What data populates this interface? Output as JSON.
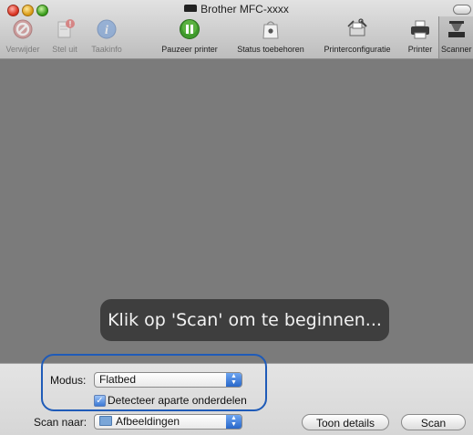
{
  "window": {
    "title": "Brother MFC-xxxx"
  },
  "toolbar": {
    "items": [
      {
        "label": "Verwijder",
        "icon": "delete-icon",
        "disabled": true
      },
      {
        "label": "Stel uit",
        "icon": "hold-icon",
        "disabled": true
      },
      {
        "label": "Taakinfo",
        "icon": "info-icon",
        "disabled": true
      },
      {
        "label": "Pauzeer printer",
        "icon": "pause-icon",
        "disabled": false
      },
      {
        "label": "Status toebehoren",
        "icon": "supplies-icon",
        "disabled": false
      },
      {
        "label": "Printerconfiguratie",
        "icon": "configure-icon",
        "disabled": false
      },
      {
        "label": "Printer",
        "icon": "printer-icon",
        "disabled": false
      },
      {
        "label": "Scanner",
        "icon": "scanner-icon",
        "disabled": false
      }
    ]
  },
  "preview": {
    "hint": "Klik op 'Scan' om te beginnen..."
  },
  "panel": {
    "mode_label": "Modus:",
    "mode_value": "Flatbed",
    "detect_label": "Detecteer aparte onderdelen",
    "detect_checked": true,
    "scan_to_label": "Scan naar:",
    "scan_to_value": "Afbeeldingen",
    "details_button": "Toon details",
    "scan_button": "Scan"
  },
  "colors": {
    "highlight": "#1f5bb8",
    "preview_bg": "#7b7b7b",
    "hint_bg": "#3e3e3e"
  }
}
